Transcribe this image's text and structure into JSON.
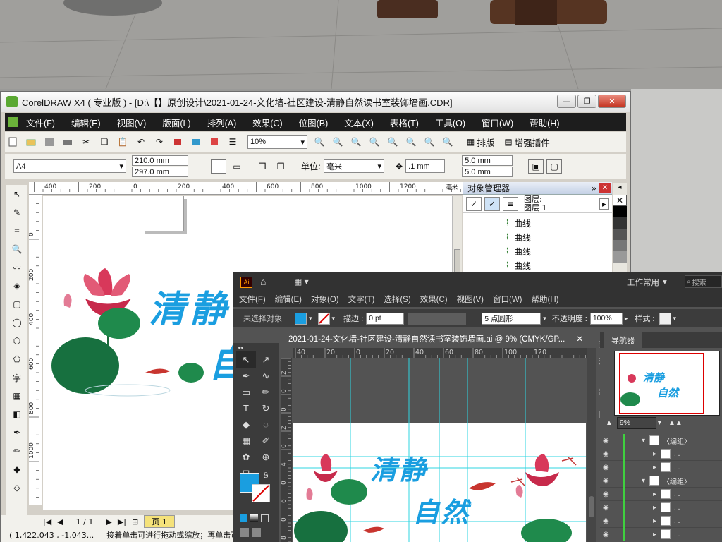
{
  "colors": {
    "corel_menu_bg": "#1d1d1d",
    "ai_bg": "#535353",
    "accent_blue": "#1a9ee0",
    "lotus_pink": "#d8385a",
    "leaf_green": "#1f8a4c",
    "guide_cyan": "#2fd4e0"
  },
  "corel": {
    "title": "CorelDRAW X4 ( 专业版 ) - [D:\\【】原创设计\\2021-01-24-文化墙-社区建设-清静自然读书室装饰墙画.CDR]",
    "menu": [
      "文件(F)",
      "编辑(E)",
      "视图(V)",
      "版面(L)",
      "排列(A)",
      "效果(C)",
      "位图(B)",
      "文本(X)",
      "表格(T)",
      "工具(O)",
      "窗口(W)",
      "帮助(H)"
    ],
    "zoom": "10%",
    "toolbar_right": [
      "排版",
      "增强插件"
    ],
    "page_size": "A4",
    "width": "210.0 mm",
    "height": "297.0 mm",
    "unit_label": "单位:",
    "unit": "毫米",
    "nudge": ".1 mm",
    "dup_x": "5.0 mm",
    "dup_y": "5.0 mm",
    "ruler_h": [
      "400",
      "200",
      "0",
      "200",
      "400",
      "600",
      "800",
      "1000",
      "1200"
    ],
    "ruler_h_unit": "毫米",
    "ruler_v": [
      "0",
      "200",
      "400",
      "600",
      "800",
      "1000"
    ],
    "objmgr": {
      "title": "对象管理器",
      "layer1": "图层:",
      "layer2": "图层 1",
      "items": [
        "曲线",
        "曲线",
        "曲线",
        "曲线"
      ]
    },
    "art_title_1": "清静",
    "art_title_2": "自",
    "page_counter": "1 / 1",
    "page_tab": "页 1",
    "status_coords": "( 1,422.043 , -1,043...",
    "status_hint": "接着单击可进行拖动或缩放；再单击可..."
  },
  "ai": {
    "workspace": "工作常用",
    "search_placeholder": "搜索",
    "menu": [
      "文件(F)",
      "编辑(E)",
      "对象(O)",
      "文字(T)",
      "选择(S)",
      "效果(C)",
      "视图(V)",
      "窗口(W)",
      "帮助(H)"
    ],
    "no_selection": "未选择对象",
    "stroke_label": "描边 :",
    "stroke_value": "0 pt",
    "brush": "5 点圆形",
    "opacity_label": "不透明度 :",
    "opacity": "100%",
    "style_label": "样式 :",
    "doc_tab": "2021-01-24-文化墙-社区建设-清静自然读书室装饰墙画.ai @ 9% (CMYK/GP...",
    "ruler_h": [
      "40",
      "20",
      "0",
      "20",
      "40",
      "60",
      "80",
      "100",
      "120"
    ],
    "ruler_v": [
      "2",
      "0",
      "0",
      "2",
      "0",
      "4",
      "0",
      "6",
      "0",
      "8"
    ],
    "art_title_1": "清静",
    "art_title_2": "自然",
    "navigator": "导航器",
    "nav_title_1": "清静",
    "nav_title_2": "自然",
    "nav_zoom": "9%",
    "layers": [
      {
        "label": "〈编组〉",
        "depth": 0
      },
      {
        "label": ". . .",
        "depth": 1
      },
      {
        "label": ". . .",
        "depth": 1
      },
      {
        "label": "〈编组〉",
        "depth": 0
      },
      {
        "label": ". . .",
        "depth": 1
      },
      {
        "label": ". . .",
        "depth": 1
      },
      {
        "label": ". . .",
        "depth": 1
      },
      {
        "label": ". . .",
        "depth": 1
      }
    ],
    "side_letters": [
      "变",
      "形",
      "路",
      "图"
    ]
  }
}
